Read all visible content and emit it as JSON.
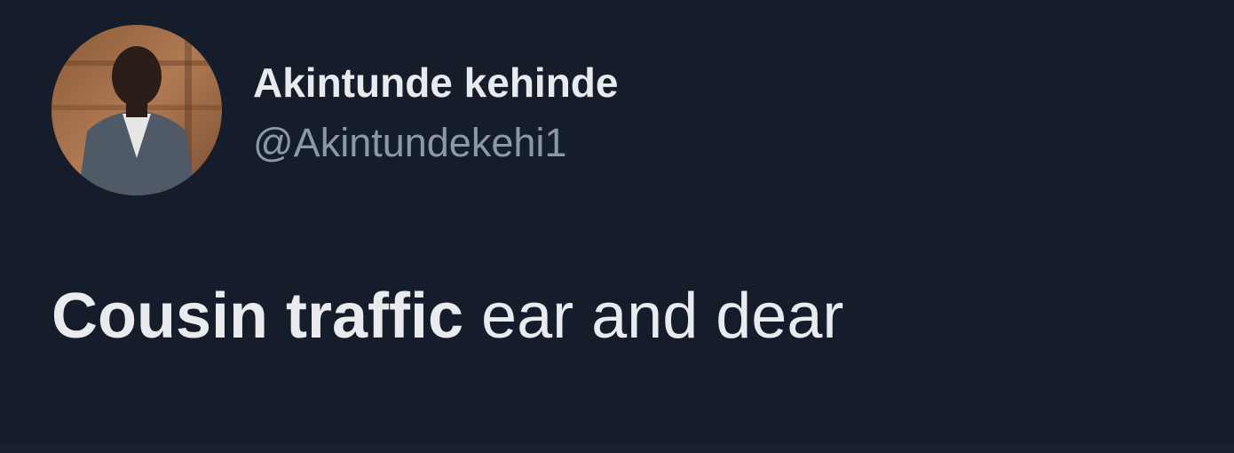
{
  "user": {
    "display_name": "Akintunde kehinde",
    "handle": "@Akintundekehi1"
  },
  "tweet": {
    "text_bold": "Cousin traffic",
    "text_regular": "ear and dear"
  },
  "colors": {
    "background": "#151d2b",
    "name_text": "#e8eaee",
    "handle_text": "#8b98a5",
    "body_text": "#e9ebee"
  }
}
